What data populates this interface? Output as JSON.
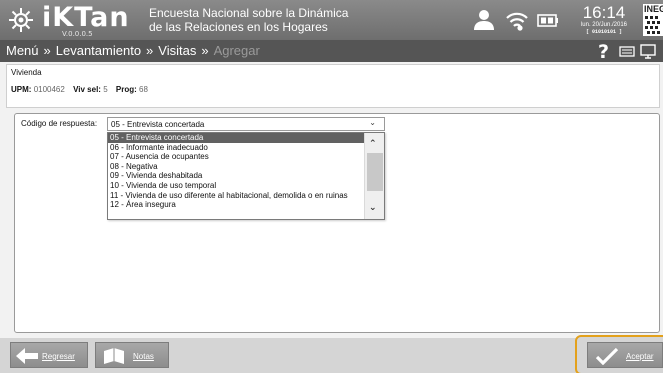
{
  "header": {
    "logo_text": "iKTan",
    "logo_version": "V.0.0.0.5",
    "survey_title_line1": "Encuesta Nacional sobre la Dinámica",
    "survey_title_line2": "de las Relaciones en los Hogares",
    "time": "16:14",
    "date": "lun. 20/Jun./2016",
    "code": "[ 01010101 ]",
    "agency": "INEGI"
  },
  "breadcrumb": {
    "menu": "Menú",
    "separator": "»",
    "levantamiento": "Levantamiento",
    "visitas": "Visitas",
    "agregar": "Agregar"
  },
  "vivienda": {
    "heading": "Vivienda",
    "upm_label": "UPM:",
    "upm_value": "0100462",
    "viv_sel_label": "Viv sel:",
    "viv_sel_value": "5",
    "prog_label": "Prog:",
    "prog_value": "68"
  },
  "form": {
    "response_label": "Código de respuesta:",
    "selected_value": "05 - Entrevista concertada",
    "options": [
      "05 - Entrevista concertada",
      "06 - Informante inadecuado",
      "07 - Ausencia de ocupantes",
      "08 - Negativa",
      "09 - Vivienda deshabitada",
      "10 - Vivienda de uso temporal",
      "11 - Vivienda de uso diferente al habitacional, demolida o en ruinas",
      "12 - Área insegura"
    ]
  },
  "footer": {
    "back_label": "Regresar",
    "notes_label": "Notas",
    "accept_label": "Aceptar"
  },
  "colors": {
    "header_bg": "#7a7a7a",
    "nav_bg": "#555555",
    "selected_option_bg": "#616161",
    "accept_highlight": "#e3a11c"
  }
}
